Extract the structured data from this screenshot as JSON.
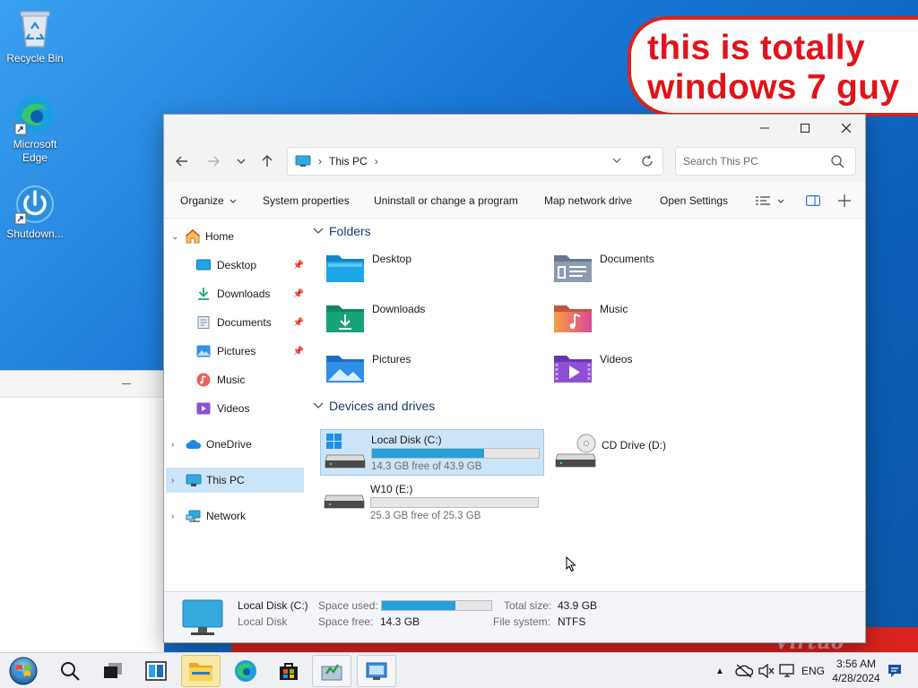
{
  "desktop": {
    "icons": [
      {
        "label": "Recycle Bin"
      },
      {
        "label": "Microsoft Edge"
      },
      {
        "label": "Shutdown..."
      }
    ],
    "overlay_text": "this is totally windows 7 guy",
    "watermark": "Virtuo"
  },
  "window": {
    "address": {
      "path": [
        "This PC"
      ]
    },
    "search": {
      "placeholder": "Search This PC"
    },
    "commands": [
      "Organize",
      "System properties",
      "Uninstall or change a program",
      "Map network drive",
      "Open Settings"
    ],
    "nav": {
      "home": "Home",
      "quick_access": [
        {
          "label": "Desktop",
          "pinned": true
        },
        {
          "label": "Downloads",
          "pinned": true
        },
        {
          "label": "Documents",
          "pinned": true
        },
        {
          "label": "Pictures",
          "pinned": true
        },
        {
          "label": "Music",
          "pinned": false
        },
        {
          "label": "Videos",
          "pinned": false
        }
      ],
      "onedrive": "OneDrive",
      "this_pc": "This PC",
      "network": "Network"
    },
    "folders_header": "Folders",
    "folders": [
      {
        "name": "Desktop",
        "icon": "desktop-folder-icon",
        "color": "#1ea7e8"
      },
      {
        "name": "Documents",
        "icon": "documents-folder-icon",
        "color": "#7d8ea4"
      },
      {
        "name": "Downloads",
        "icon": "downloads-folder-icon",
        "color": "#16a37a"
      },
      {
        "name": "Music",
        "icon": "music-folder-icon",
        "color": "#e8605f"
      },
      {
        "name": "Pictures",
        "icon": "pictures-folder-icon",
        "color": "#2f8fe6"
      },
      {
        "name": "Videos",
        "icon": "videos-folder-icon",
        "color": "#8e4fd6"
      }
    ],
    "drives_header": "Devices and drives",
    "drives": [
      {
        "name": "Local Disk (C:)",
        "free": "14.3 GB free of 43.9 GB",
        "used_fraction": 0.674
      },
      {
        "name": "W10 (E:)",
        "free": "25.3 GB free of 25.3 GB",
        "used_fraction": 0.0
      },
      {
        "name": "CD Drive (D:)"
      }
    ],
    "details": {
      "name": "Local Disk (C:)",
      "type": "Local Disk",
      "space_used_label": "Space used:",
      "space_used_fraction": 0.674,
      "space_free_label": "Space free:",
      "space_free": "14.3 GB",
      "total_size_label": "Total size:",
      "total_size": "43.9 GB",
      "file_system_label": "File system:",
      "file_system": "NTFS"
    }
  },
  "taskbar": {
    "tray": {
      "language": "ENG"
    },
    "clock": {
      "time": "3:56 AM",
      "date": "4/28/2024"
    }
  },
  "colors": {
    "accent": "#26a0da",
    "selection": "#cce4f7",
    "bubble_text": "#e0141a"
  }
}
